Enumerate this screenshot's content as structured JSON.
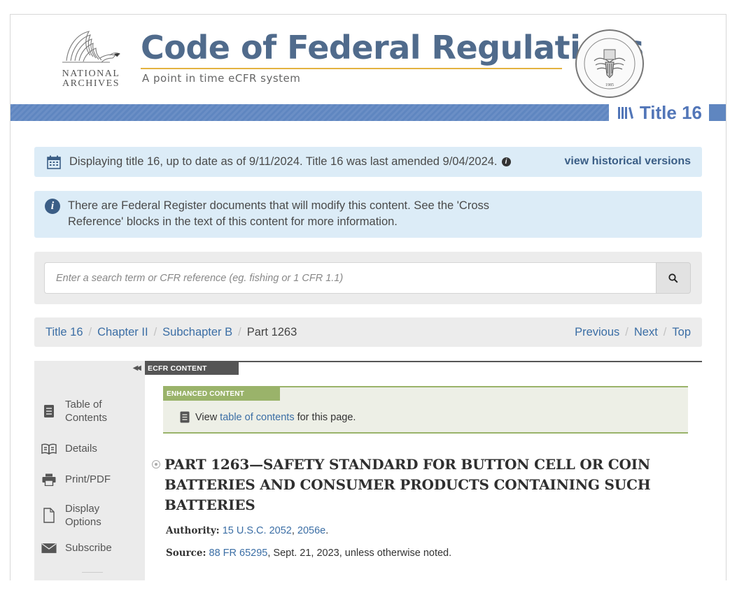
{
  "header": {
    "org_line1": "NATIONAL",
    "org_line2": "ARCHIVES",
    "site_title": "Code of Federal Regulations",
    "site_subtitle": "A point in time eCFR system",
    "title_badge": "Title 16"
  },
  "alerts": {
    "date_text": "Displaying title 16, up to date as of 9/11/2024. Title 16 was last amended 9/04/2024.",
    "historical_link": "view historical versions",
    "fr_text_line1": "There are Federal Register documents that will modify this content. See the 'Cross",
    "fr_text_line2": "Reference' blocks in the text of this content for more information."
  },
  "search": {
    "placeholder": "Enter a search term or CFR reference (eg. fishing or 1 CFR 1.1)",
    "value": ""
  },
  "breadcrumb": {
    "items": [
      "Title 16",
      "Chapter II",
      "Subchapter B"
    ],
    "current": "Part 1263",
    "previous": "Previous",
    "next": "Next",
    "top": "Top"
  },
  "sidebar": {
    "items": [
      {
        "line1": "Table of",
        "line2": "Contents",
        "icon": "document-icon"
      },
      {
        "line1": "Details",
        "line2": "",
        "icon": "book-icon"
      },
      {
        "line1": "Print/PDF",
        "line2": "",
        "icon": "printer-icon"
      },
      {
        "line1": "Display",
        "line2": "Options",
        "icon": "page-icon"
      },
      {
        "line1": "Subscribe",
        "line2": "",
        "icon": "envelope-icon"
      }
    ]
  },
  "content": {
    "ecfr_tab": "ECFR CONTENT",
    "enhanced_tab": "ENHANCED CONTENT",
    "view_prefix": "View",
    "toc_link": "table of contents",
    "view_suffix": "for this page.",
    "part_heading": "PART 1263—SAFETY STANDARD FOR BUTTON CELL OR COIN BATTERIES AND CONSUMER PRODUCTS CONTAINING SUCH BATTERIES",
    "authority_label": "Authority:",
    "authority_link1": "15 U.S.C. 2052",
    "authority_link2": "2056e",
    "source_label": "Source:",
    "source_link": "88 FR 65295",
    "source_suffix": ", Sept. 21, 2023, unless otherwise noted."
  },
  "colors": {
    "title_blue": "#506b8c",
    "link_blue": "#3b6ea5",
    "alert_bg": "#dcecf7",
    "enhanced_green": "#9ab36a",
    "gold": "#e3b240"
  }
}
